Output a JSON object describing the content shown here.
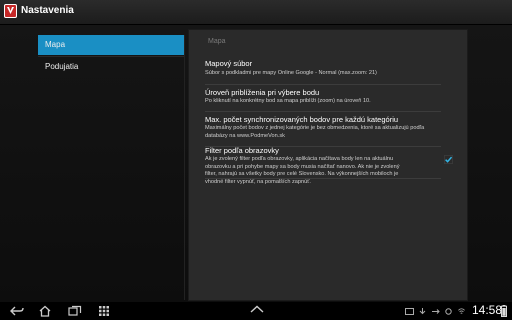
{
  "app": {
    "title": "Nastavenia"
  },
  "sidebar": {
    "items": [
      {
        "label": "Mapa",
        "active": true
      },
      {
        "label": "Podujatia",
        "active": false
      }
    ]
  },
  "main": {
    "category_title": "Mapa",
    "prefs": [
      {
        "title": "Mapový súbor",
        "summary": "Súbor s podkladmi pre mapy Online Google - Normal (max.zoom: 21)"
      },
      {
        "title": "Úroveň priblíženia pri výbere bodu",
        "summary": "Po kliknutí na konkrétny bod sa mapa priblíži (zoom) na úroveň 10."
      },
      {
        "title": "Max. počet synchronizovaných bodov pre každú kategóriu",
        "summary": "Maximálny počet bodov z jednej kategórie je bez obmedzenia, ktoré sa aktualizujú podľa databázy na www.PodmeVon.sk"
      },
      {
        "title": "Filter podľa obrazovky",
        "summary": "Ak je zvolený filter podľa obrazovky, aplikácia načítava body len na aktuálnu obrazovku a pri pohybe mapy sa body musia načítať nanovo. Ak nie je zvolený filter, nahrajú sa všetky body pre celé Slovensko. Na výkonnejších mobiloch je vhodné filter vypnúť, na pomalších zapnúť.",
        "checked": true
      }
    ]
  },
  "status_bar": {
    "time": "14:58"
  },
  "colors": {
    "accent": "#1a8fc4",
    "app_icon": "#c62828",
    "check": "#33b5e5"
  }
}
